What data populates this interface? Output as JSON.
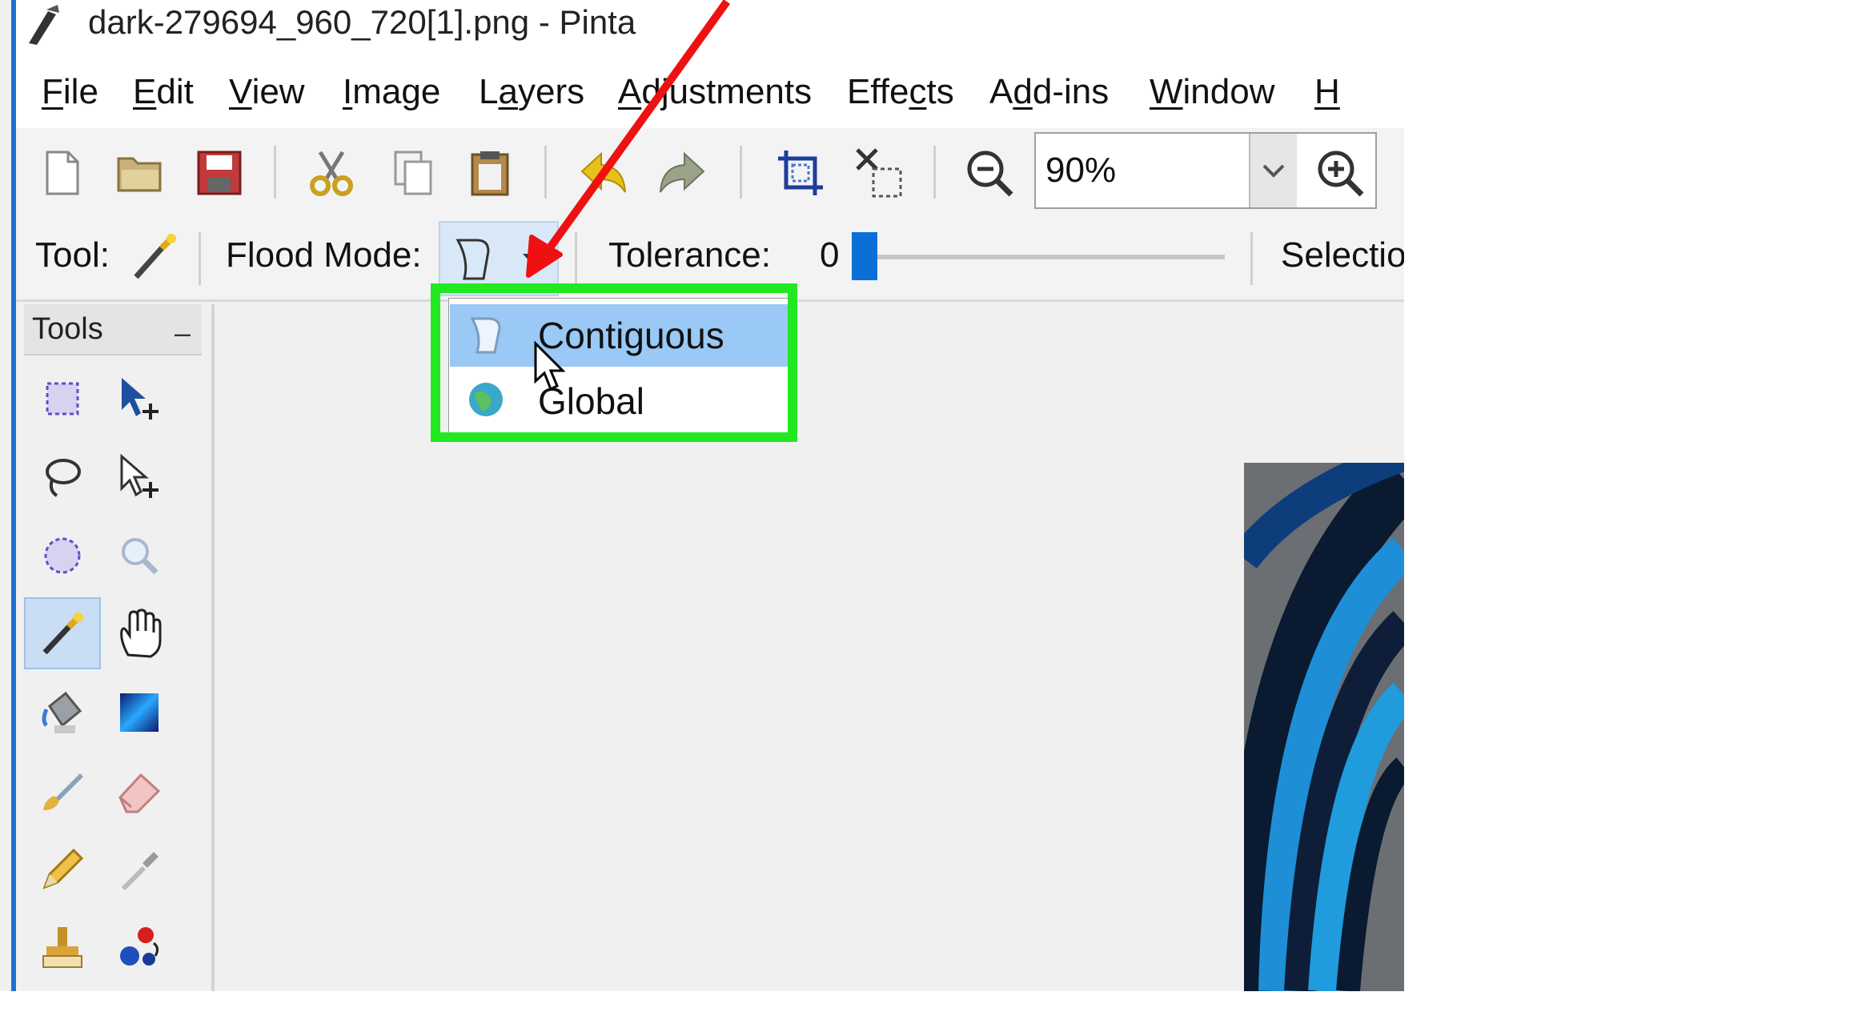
{
  "window": {
    "title": "dark-279694_960_720[1].png - Pinta"
  },
  "menu": {
    "items": [
      {
        "label": "File",
        "hotkey": "F",
        "rest": "ile"
      },
      {
        "label": "Edit",
        "hotkey": "E",
        "rest": "dit"
      },
      {
        "label": "View",
        "hotkey": "V",
        "rest": "iew"
      },
      {
        "label": "Image",
        "hotkey": "I",
        "rest": "mage"
      },
      {
        "label": "Layers",
        "pre": "L",
        "hotkey": "a",
        "rest": "yers"
      },
      {
        "label": "Adjustments",
        "hotkey": "A",
        "rest": "djustments"
      },
      {
        "label": "Effects",
        "pre": "Effe",
        "hotkey": "c",
        "rest": "ts"
      },
      {
        "label": "Add-ins",
        "pre": "A",
        "hotkey": "d",
        "rest": "d-ins"
      },
      {
        "label": "Window",
        "hotkey": "W",
        "rest": "indow"
      },
      {
        "label": "Help",
        "hotkey": "H",
        "rest": ""
      }
    ]
  },
  "toolbar": {
    "buttons": [
      "new-icon",
      "open-icon",
      "save-icon",
      "cut-icon",
      "copy-icon",
      "paste-icon",
      "undo-icon",
      "redo-icon",
      "crop-icon",
      "deselect-icon",
      "zoom-out-icon",
      "zoom-in-icon"
    ],
    "zoom_value": "90%"
  },
  "tool_options": {
    "tool_label": "Tool:",
    "flood_mode_label": "Flood Mode:",
    "tolerance_label": "Tolerance:",
    "tolerance_value": "0",
    "selection_label": "Selectio"
  },
  "flood_mode_menu": {
    "items": [
      {
        "label": "Contiguous",
        "selected": true,
        "icon": "contiguous-icon"
      },
      {
        "label": "Global",
        "selected": false,
        "icon": "global-icon"
      }
    ]
  },
  "tools_panel": {
    "title": "Tools",
    "collapse_label": "–",
    "active_tool": "magic-wand"
  },
  "annotations": {
    "arrow_color": "#ee1111",
    "highlight_color": "#22e822"
  }
}
